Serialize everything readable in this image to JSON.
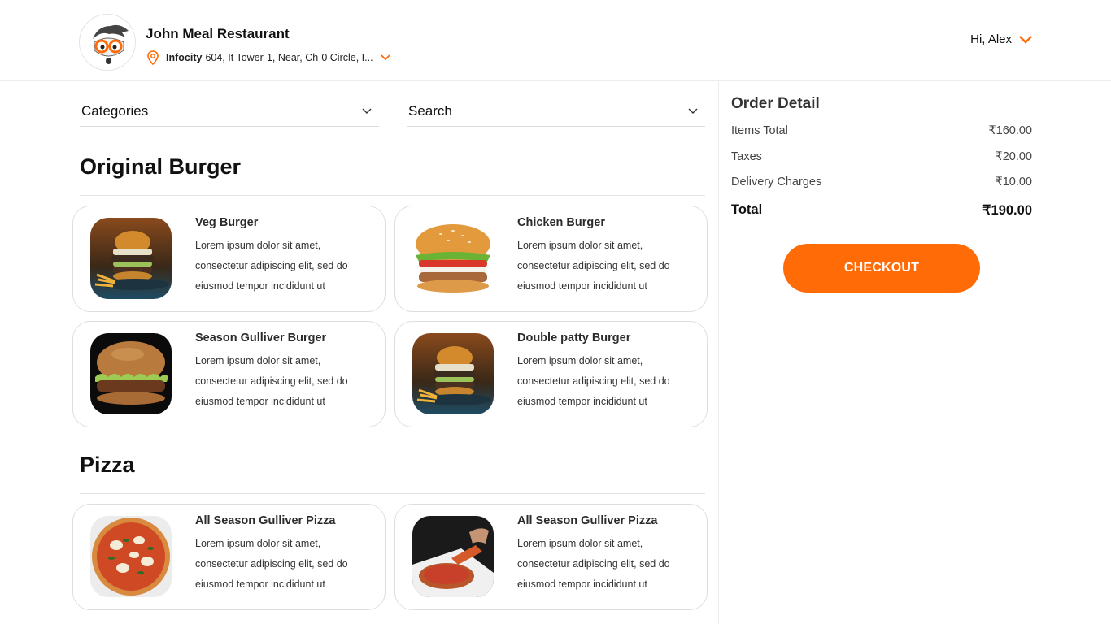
{
  "header": {
    "restaurant_name": "John Meal Restaurant",
    "address_bold": "Infocity",
    "address_rest": "604, It Tower-1, Near, Ch-0 Circle, I...",
    "greeting": "Hi, Alex"
  },
  "filters": {
    "categories_label": "Categories",
    "search_label": "Search"
  },
  "sections": [
    {
      "title": "Original Burger",
      "items": [
        {
          "name": "Veg Burger",
          "desc": "Lorem ipsum dolor sit amet, consectetur adipiscing elit, sed do eiusmod tempor incididunt ut"
        },
        {
          "name": "Chicken Burger",
          "desc": "Lorem ipsum dolor sit amet, consectetur adipiscing elit, sed do eiusmod tempor incididunt ut"
        },
        {
          "name": "Season Gulliver Burger",
          "desc": "Lorem ipsum dolor sit amet, consectetur adipiscing elit, sed do eiusmod tempor incididunt ut"
        },
        {
          "name": "Double patty Burger",
          "desc": "Lorem ipsum dolor sit amet, consectetur adipiscing elit, sed do eiusmod tempor incididunt ut"
        }
      ]
    },
    {
      "title": "Pizza",
      "items": [
        {
          "name": "All Season Gulliver Pizza",
          "desc": "Lorem ipsum dolor sit amet, consectetur adipiscing elit, sed do eiusmod tempor incididunt ut"
        },
        {
          "name": "All Season Gulliver Pizza",
          "desc": "Lorem ipsum dolor sit amet, consectetur adipiscing elit, sed do eiusmod tempor incididunt ut"
        }
      ]
    }
  ],
  "order": {
    "title": "Order Detail",
    "rows": [
      {
        "label": "Items Total",
        "value": "₹160.00"
      },
      {
        "label": "Taxes",
        "value": "₹20.00"
      },
      {
        "label": "Delivery Charges",
        "value": "₹10.00"
      }
    ],
    "total_label": "Total",
    "total_value": "₹190.00",
    "checkout_label": "CHECKOUT"
  },
  "colors": {
    "accent": "#ff6b06"
  }
}
